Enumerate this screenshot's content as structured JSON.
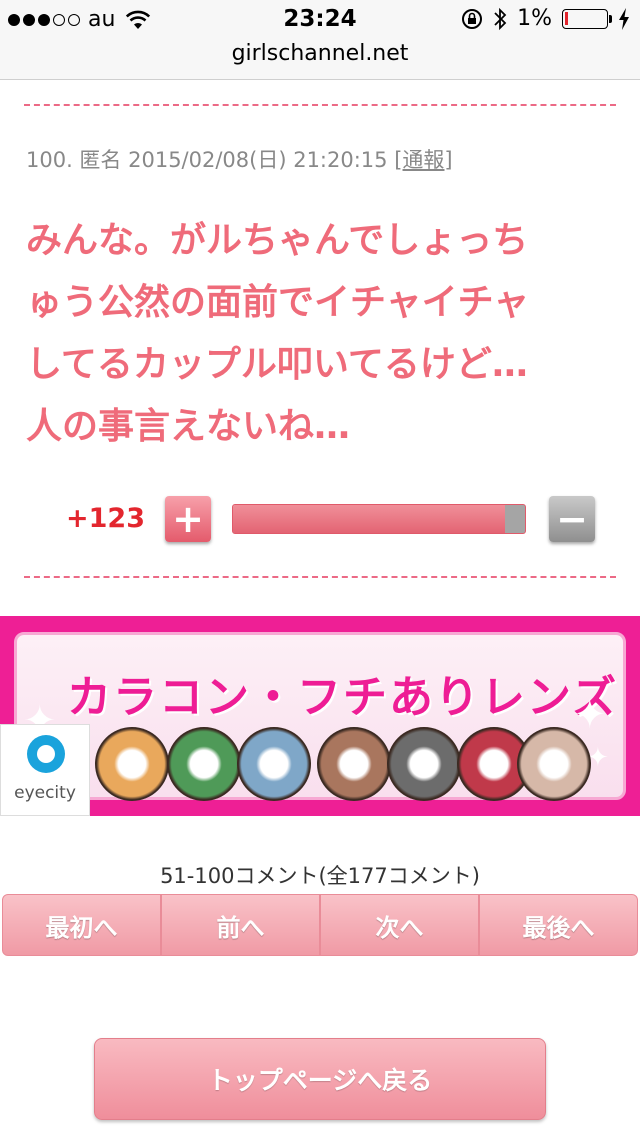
{
  "status_bar": {
    "carrier": "au",
    "time": "23:24",
    "battery_percent": "1%",
    "signal_bars_filled": 3,
    "signal_bars_total": 5,
    "battery_level": 0.01
  },
  "url_bar": {
    "domain": "girlschannel.net"
  },
  "comment": {
    "meta": "100. 匿名 2015/02/08(日) 21:20:15",
    "report_label": "[通報]",
    "lines": [
      "みんな。がルちゃんでしょっち",
      "ゅう公然の面前でイチャイチャ",
      "してるカップル叩いてるけど…",
      "人の事言えないね…"
    ],
    "color": "#ef6b7a"
  },
  "vote": {
    "score": "+123",
    "plus_label": "+",
    "minus_label": "−",
    "plus_ratio": 0.93
  },
  "ad_banner": {
    "title": "カラコン・フチありレンズ",
    "logo_text": "eyecity",
    "accent": "#ee1f95",
    "lenses": [
      "#e9a85c",
      "#4f9a58",
      "#7fa7c8",
      "#a9765e",
      "#6c6c6c",
      "#c0394a",
      "#d6b8a8"
    ]
  },
  "pager": {
    "summary": "51-100コメント(全177コメント)",
    "first": "最初へ",
    "prev": "前へ",
    "next": "次へ",
    "last": "最後へ"
  },
  "top_button": {
    "label": "トップページへ戻る"
  }
}
